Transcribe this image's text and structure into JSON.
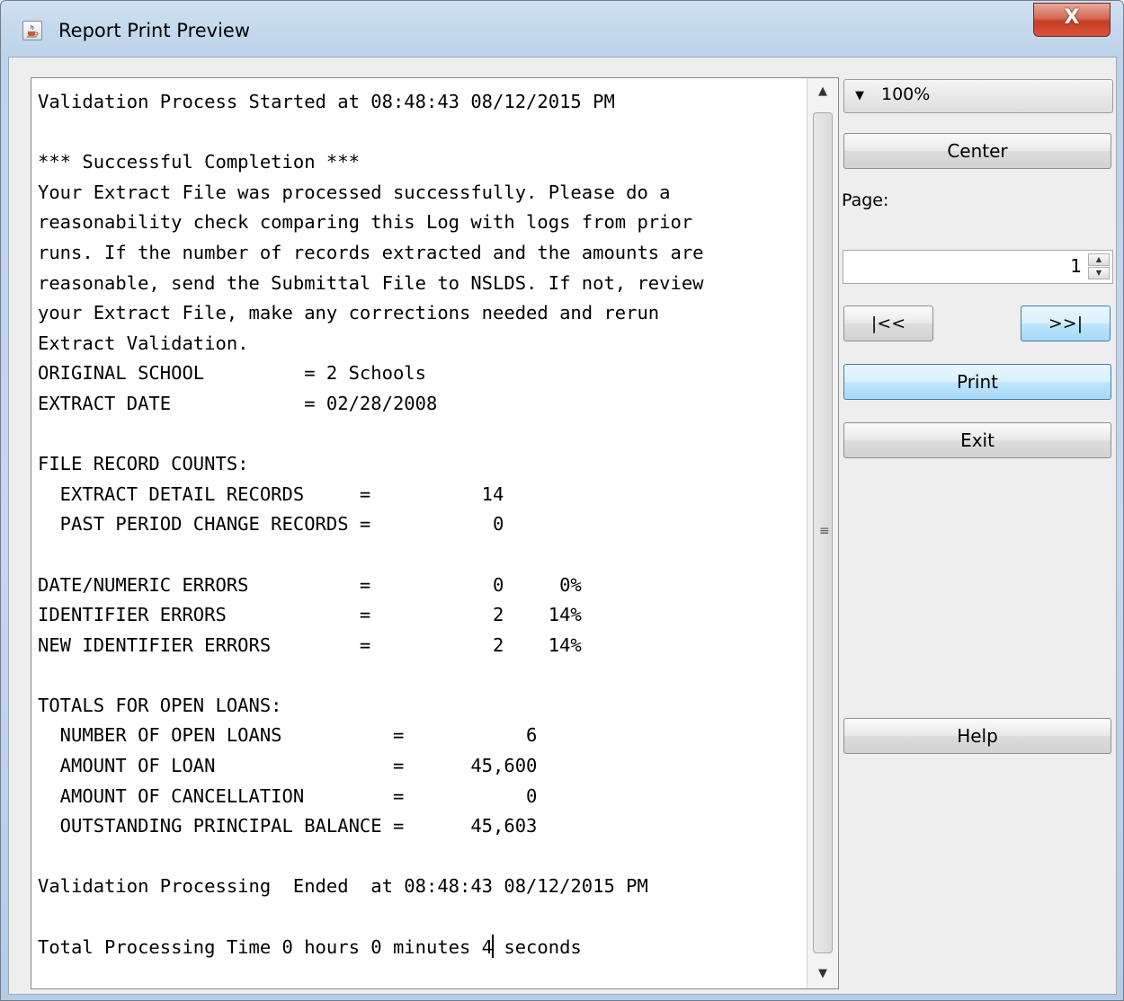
{
  "window": {
    "title": "Report Print Preview",
    "close_label": "X"
  },
  "report": {
    "lines": [
      "Validation Process Started at 08:48:43 08/12/2015 PM",
      "",
      "*** Successful Completion ***",
      "Your Extract File was processed successfully. Please do a",
      "reasonability check comparing this Log with logs from prior",
      "runs. If the number of records extracted and the amounts are",
      "reasonable, send the Submittal File to NSLDS. If not, review",
      "your Extract File, make any corrections needed and rerun",
      "Extract Validation.",
      "ORIGINAL SCHOOL         = 2 Schools",
      "EXTRACT DATE            = 02/28/2008",
      "",
      "FILE RECORD COUNTS:",
      "  EXTRACT DETAIL RECORDS     =          14",
      "  PAST PERIOD CHANGE RECORDS =           0",
      "",
      "DATE/NUMERIC ERRORS          =           0     0%",
      "IDENTIFIER ERRORS            =           2    14%",
      "NEW IDENTIFIER ERRORS        =           2    14%",
      "",
      "TOTALS FOR OPEN LOANS:",
      "  NUMBER OF OPEN LOANS          =           6",
      "  AMOUNT OF LOAN                =      45,600",
      "  AMOUNT OF CANCELLATION        =           0",
      "  OUTSTANDING PRINCIPAL BALANCE =      45,603",
      "",
      "Validation Processing  Ended  at 08:48:43 08/12/2015 PM",
      ""
    ],
    "last_line_before_caret": "Total Processing Time 0 hours 0 minutes 4",
    "last_line_after_caret": " seconds"
  },
  "controls": {
    "zoom_value": "100%",
    "center_label": "Center",
    "page_label": "Page:",
    "page_value": "1",
    "first_label": "|<<",
    "last_label": ">>|",
    "print_label": "Print",
    "exit_label": "Exit",
    "help_label": "Help"
  },
  "icons": {
    "app": "java-cup-icon",
    "close": "close-icon",
    "zoom_dropdown": "triangle-down-icon",
    "scroll_up": "triangle-up-icon",
    "scroll_down": "triangle-down-icon",
    "scroll_grip": "grip-icon"
  }
}
